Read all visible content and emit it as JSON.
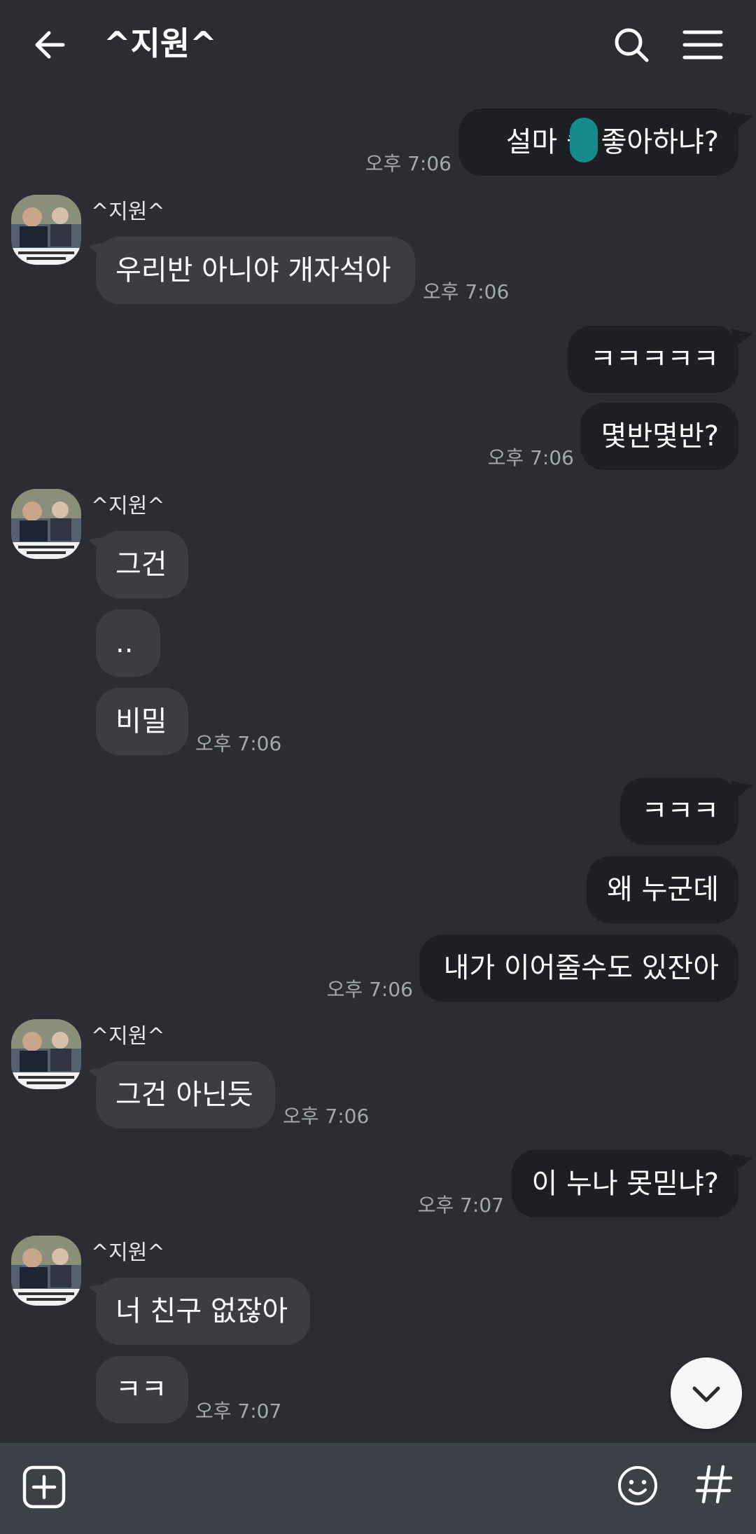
{
  "header": {
    "title": "^지원^"
  },
  "icons": {
    "back": "arrow-left-icon",
    "search": "search-icon",
    "menu": "hamburger-menu-icon",
    "scroll_down": "chevron-down-icon",
    "add": "plus-square-icon",
    "emoji": "smiley-icon",
    "hashtag": "hashtag-icon"
  },
  "colors": {
    "background": "#2b2d33",
    "outgoing_bubble": "#1e1f23",
    "incoming_bubble": "#3b3d43",
    "timestamp": "#a5a8ad",
    "composer": "#3d4046"
  },
  "messages": [
    {
      "direction": "out",
      "text": "설마 솔  좋아하냐?",
      "time": "오후 7:06",
      "redacted": true
    },
    {
      "direction": "in",
      "sender": "^지원^",
      "text": "우리반 아니야 개자석아",
      "time": "오후 7:06"
    },
    {
      "direction": "out",
      "text": "ㅋㅋㅋㅋㅋ"
    },
    {
      "direction": "out",
      "text": "몇반몇반?",
      "time": "오후 7:06"
    },
    {
      "direction": "in",
      "sender": "^지원^",
      "text": "그건"
    },
    {
      "direction": "in",
      "text": ".."
    },
    {
      "direction": "in",
      "text": "비밀",
      "time": "오후 7:06"
    },
    {
      "direction": "out",
      "text": "ㅋㅋㅋ"
    },
    {
      "direction": "out",
      "text": "왜 누군데"
    },
    {
      "direction": "out",
      "text": "내가 이어줄수도 있잔아",
      "time": "오후 7:06"
    },
    {
      "direction": "in",
      "sender": "^지원^",
      "text": "그건 아닌듯",
      "time": "오후 7:06"
    },
    {
      "direction": "out",
      "text": "이 누나 못믿냐?",
      "time": "오후 7:07"
    },
    {
      "direction": "in",
      "sender": "^지원^",
      "text": "너 친구 없잖아"
    },
    {
      "direction": "in",
      "text": "ㅋㅋ",
      "time": "오후 7:07"
    }
  ]
}
